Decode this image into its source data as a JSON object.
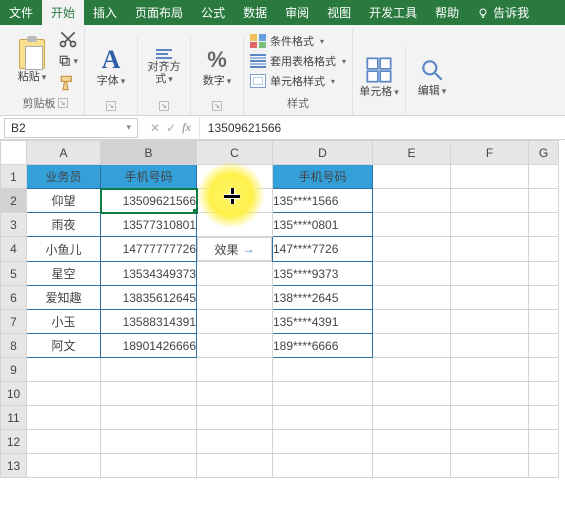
{
  "tabs": {
    "file": "文件",
    "home": "开始",
    "insert": "插入",
    "layout": "页面布局",
    "formulas": "公式",
    "data": "数据",
    "review": "审阅",
    "view": "视图",
    "dev": "开发工具",
    "help": "帮助",
    "tell": "告诉我"
  },
  "ribbon": {
    "paste": "粘贴",
    "clipboard": "剪贴板",
    "font": "字体",
    "align": "对齐方式",
    "number": "数字",
    "cond_format": "条件格式",
    "table_format": "套用表格格式",
    "cell_style": "单元格样式",
    "styles": "样式",
    "cells": "单元格",
    "editing": "编辑"
  },
  "namebox": "B2",
  "formula": "13509621566",
  "cols": [
    "A",
    "B",
    "C",
    "D",
    "E",
    "F",
    "G"
  ],
  "rows": [
    "1",
    "2",
    "3",
    "4",
    "5",
    "6",
    "7",
    "8",
    "9",
    "10",
    "11",
    "12",
    "13"
  ],
  "headers": {
    "A": "业务员",
    "B": "手机号码",
    "D": "手机号码"
  },
  "effect_label": "效果",
  "tableA": [
    {
      "name": "仰望",
      "phone": "13509621566",
      "mask": "135****1566"
    },
    {
      "name": "雨夜",
      "phone": "13577310801",
      "mask": "135****0801"
    },
    {
      "name": "小鱼儿",
      "phone": "14777777726",
      "mask": "147****7726"
    },
    {
      "name": "星空",
      "phone": "13534349373",
      "mask": "135****9373"
    },
    {
      "name": "爱知趣",
      "phone": "13835612645",
      "mask": "138****2645"
    },
    {
      "name": "小玉",
      "phone": "13588314391",
      "mask": "135****4391"
    },
    {
      "name": "阿文",
      "phone": "18901426666",
      "mask": "189****6666"
    }
  ]
}
